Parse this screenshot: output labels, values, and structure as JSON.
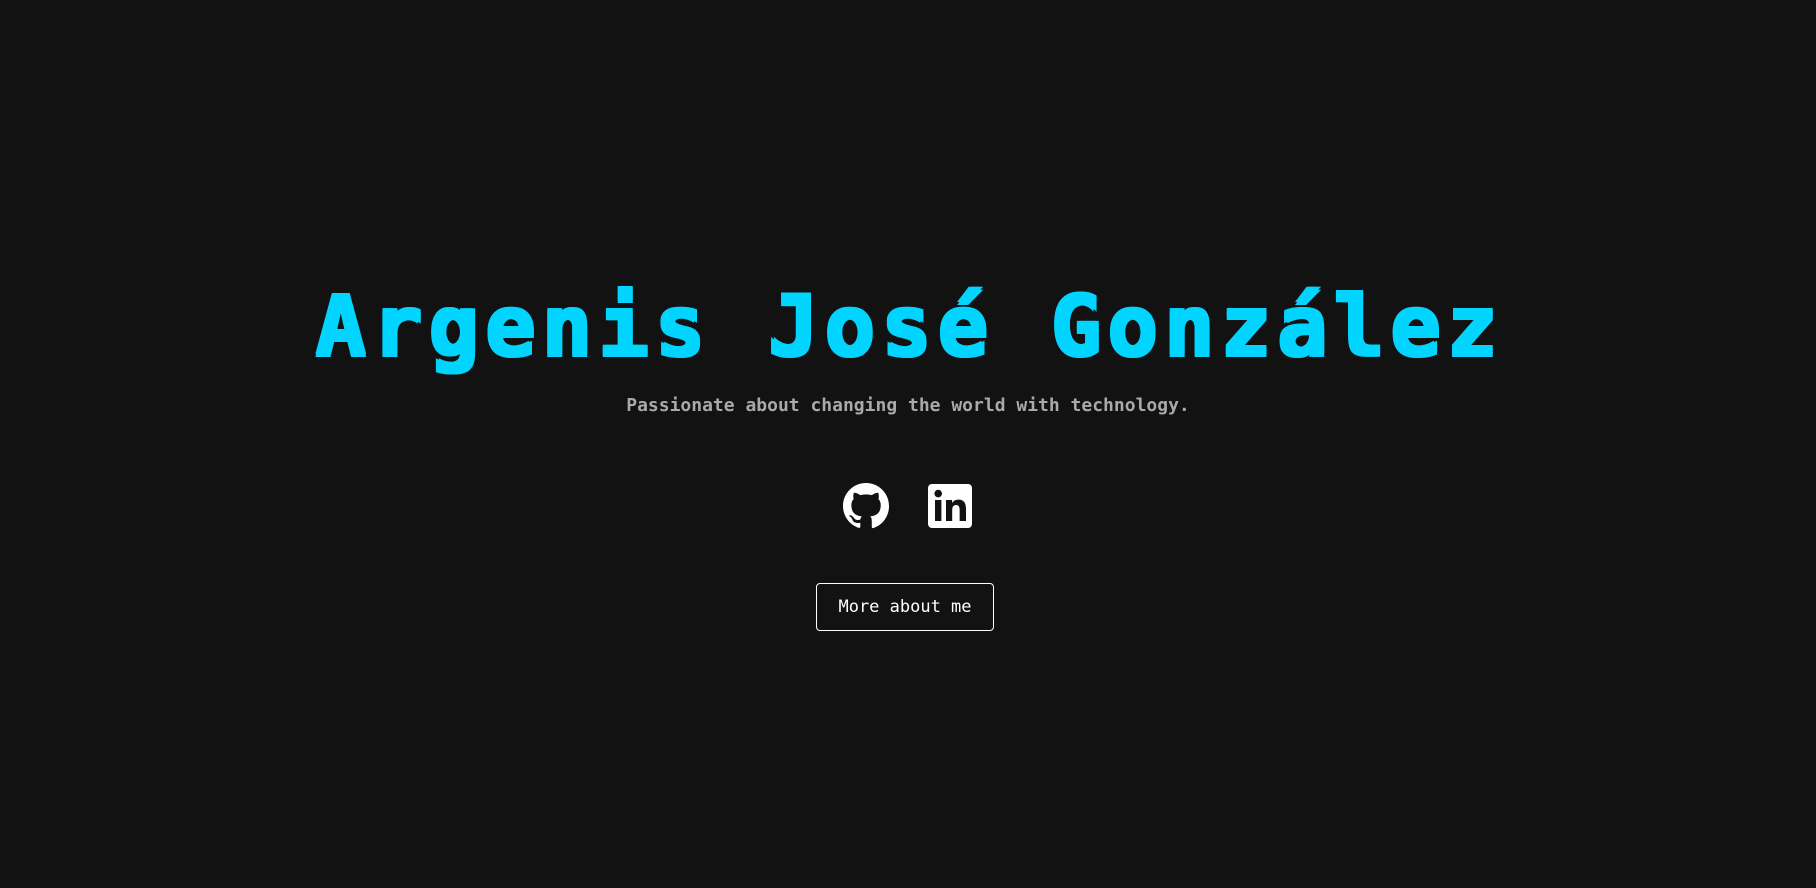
{
  "hero": {
    "name": "Argenis José González",
    "tagline": "Passionate about changing the world with technology.",
    "more_button_label": "More about me"
  },
  "social": [
    {
      "name": "GitHub",
      "icon": "github-icon"
    },
    {
      "name": "LinkedIn",
      "icon": "linkedin-icon"
    }
  ],
  "colors": {
    "background": "#121212",
    "accent": "#00d4ff",
    "tagline": "#a9a9a9",
    "button_border": "#ffffff",
    "icon": "#ffffff"
  }
}
